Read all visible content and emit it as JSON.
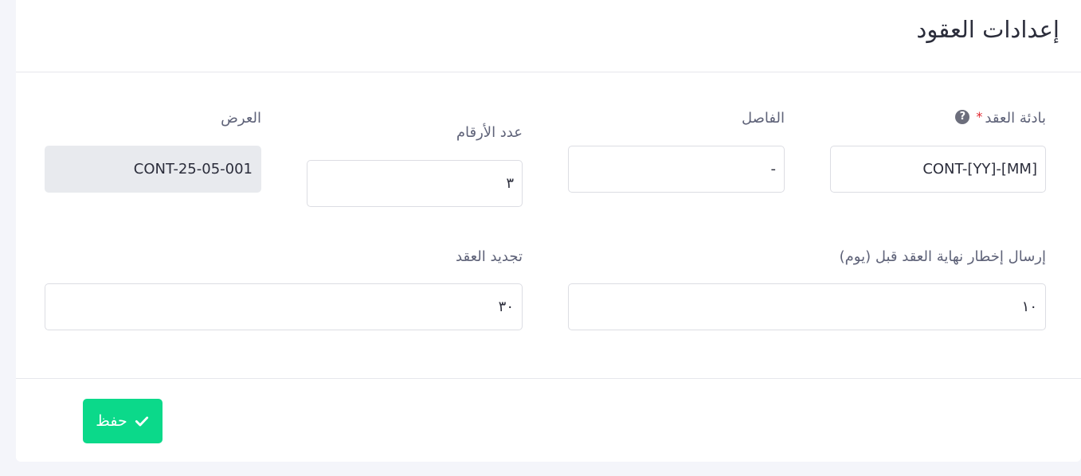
{
  "page_title": "إعدادات العقود",
  "fields": {
    "prefix": {
      "label": "بادئة العقد",
      "required_mark": "*",
      "help_icon": "question-circle-icon",
      "value": "CONT-[YY]-[MM]"
    },
    "separator": {
      "label": "الفاصل",
      "value": "-"
    },
    "digits": {
      "label": "عدد الأرقام",
      "value": "٣"
    },
    "preview": {
      "label": "العرض",
      "value": "CONT-25-05-001"
    },
    "notify_before": {
      "label": "إرسال إخطار نهاية العقد قبل (يوم)",
      "value": "١٠"
    },
    "renewal": {
      "label": "تجديد العقد",
      "value": "٣٠"
    }
  },
  "save_button": {
    "label": "حفظ",
    "icon": "check-icon"
  },
  "colors": {
    "accent": "#0bd98a",
    "required": "#e0262f",
    "readonly_bg": "#e8eaee"
  }
}
